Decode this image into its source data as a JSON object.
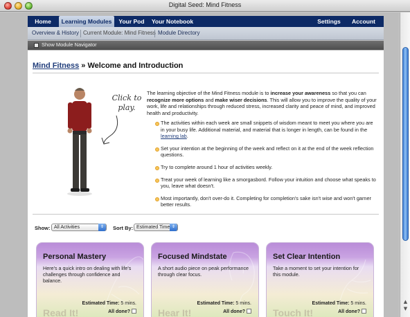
{
  "window": {
    "title": "Digital Seed: Mind Fitness"
  },
  "mainnav": {
    "tabs": [
      {
        "label": "Home"
      },
      {
        "label": "Learning Modules"
      },
      {
        "label": "Your Pod"
      },
      {
        "label": "Your Notebook"
      }
    ],
    "right": [
      {
        "label": "Settings"
      },
      {
        "label": "Account"
      }
    ]
  },
  "subnav": {
    "overview": "Overview & History",
    "current": "Current Module: Mind Fitness",
    "directory": "Module Directory"
  },
  "navigator": {
    "label": "Show Module Navigator"
  },
  "page": {
    "breadcrumb_link": "Mind Fitness",
    "separator": " » ",
    "title": "Welcome and Introduction",
    "click_to_play": "Click to play.",
    "intro_1": "The learning objective of the Mind Fitness module is to ",
    "intro_b1": "increase your awareness",
    "intro_2": " so that you can ",
    "intro_b2": "recognize more options",
    "intro_3": " and ",
    "intro_b3": "make wiser decisions",
    "intro_4": ". This will allow you to improve the quality of your work, life and relationships through reduced stress, increased clarity and peace of mind, and improved health and productivity.",
    "bullet_1a": "The activities within each week are small snippets of wisdom meant to meet you where you are in your busy life. Additional material, and material that is longer in length, can be found in the ",
    "bullet_1_link": "learning lab",
    "bullet_1b": ".",
    "bullet_2": "Set your intention at the beginning of the week and reflect on it at the end of the week reflection questions.",
    "bullet_3": "Try to complete around 1 hour of activities weekly.",
    "bullet_4": "Treat your week of learning like a smorgasbord. Follow your intuition and choose what speaks to you, leave what doesn't.",
    "bullet_5": "Most importantly, don't over-do it. Completing for completion's sake isn't wise and won't garner better results."
  },
  "filters": {
    "show_label": "Show:",
    "show_value": "All Activities",
    "sort_label": "Sort By:",
    "sort_value": "Estimated Time"
  },
  "cards": [
    {
      "title": "Personal Mastery",
      "desc": "Here's a quick intro on dealing with life's challenges through confidence and balance.",
      "time_label": "Estimated Time:",
      "time_value": " 5 mins.",
      "done_label": "All done?",
      "action": "Read It!"
    },
    {
      "title": "Focused Mindstate",
      "desc": "A short audio piece on peak performance through clear focus.",
      "time_label": "Estimated Time:",
      "time_value": " 5 mins.",
      "done_label": "All done?",
      "action": "Hear It!"
    },
    {
      "title": "Set Clear Intention",
      "desc": "Take a moment to set your intention for this module.",
      "time_label": "Estimated Time:",
      "time_value": " 5 mins.",
      "done_label": "All done?",
      "action": "Touch It!"
    }
  ],
  "colors": {
    "nav_bg": "#0d2a66",
    "link": "#1f3c7a",
    "bullet": "#f7c65a",
    "card_top": "#b98cd8"
  }
}
